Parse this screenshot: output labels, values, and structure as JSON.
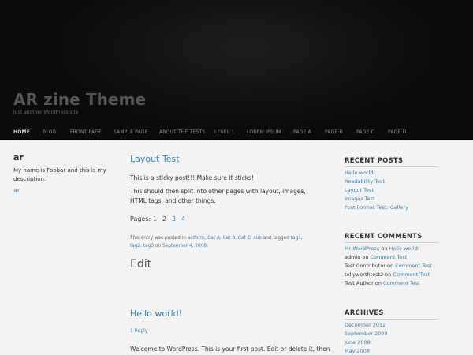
{
  "header": {
    "site_title": "AR zine Theme",
    "site_description": "Just another WordPress site"
  },
  "nav": {
    "items": [
      {
        "label": "HOME",
        "active": true
      },
      {
        "label": "BLOG"
      },
      {
        "label": "FRONT PAGE"
      },
      {
        "label": "SAMPLE PAGE"
      },
      {
        "label": "ABOUT THE TESTS"
      },
      {
        "label": "LEVEL 1"
      },
      {
        "label": "LOREM IPSUM"
      },
      {
        "label": "PAGE A"
      },
      {
        "label": "PAGE B"
      },
      {
        "label": "PAGE C"
      },
      {
        "label": "PAGE D"
      }
    ]
  },
  "author": {
    "name": "ar",
    "bio": "My name is Foobar and this is my description.",
    "link": "ar"
  },
  "posts": [
    {
      "title": "Layout Test",
      "line1": "This is a sticky post!!! Make sure it sticks!",
      "line2": "This should then split into other pages with layout, images,",
      "line3": "HTML tags, and other things.",
      "pages_label": "Pages:",
      "pages": [
        "1",
        "2",
        "3",
        "4"
      ],
      "meta_prefix": "This entry was posted in ",
      "meta_categories": "aciform, Cat A, Cat B, Cat C, sub",
      "meta_mid": " and tagged ",
      "meta_tags": "tag1, tag2, tag3",
      "meta_on": " on ",
      "meta_date": "September 4, 2008",
      "meta_end": ".",
      "edit": "Edit"
    },
    {
      "title": "Hello world!",
      "replies": "1 Reply",
      "text": "Welcome to WordPress. This is your first post. Edit or delete it, then"
    }
  ],
  "sidebar": {
    "recent_posts": {
      "title": "RECENT POSTS",
      "items": [
        "Hello world!",
        "Readability Test",
        "Layout Test",
        "Images Test",
        "Post Format Test: Gallery"
      ]
    },
    "recent_comments": {
      "title": "RECENT COMMENTS",
      "items": [
        {
          "author": "Mr WordPress",
          "on": " on ",
          "post": "Hello world!",
          "author_link": true
        },
        {
          "author": "admin",
          "on": " on ",
          "post": "Comment Test",
          "author_link": false
        },
        {
          "author": "Test Contributor",
          "on": " on ",
          "post": "Comment Test",
          "author_link": false
        },
        {
          "author": "tellyworthtest2",
          "on": " on ",
          "post": "Comment Test",
          "author_link": false
        },
        {
          "author": "Test Author",
          "on": " on ",
          "post": "Comment Test",
          "author_link": false
        }
      ]
    },
    "archives": {
      "title": "ARCHIVES",
      "items": [
        "December 2012",
        "September 2008",
        "June 2008",
        "May 2008"
      ]
    }
  },
  "colors": {
    "link": "#3a7fb0",
    "header_bg": "#0b0b0b",
    "page_bg": "#f3f3f3"
  }
}
